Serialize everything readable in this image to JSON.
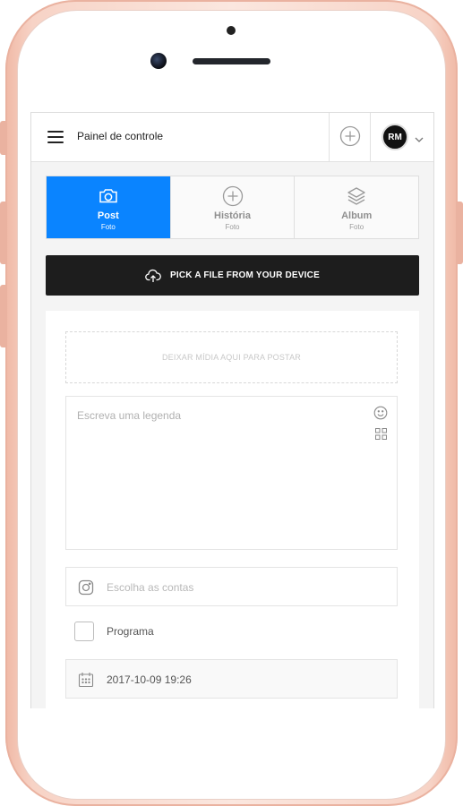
{
  "header": {
    "title": "Painel de controle",
    "avatar_initials": "RM"
  },
  "tabs": [
    {
      "label": "Post",
      "sub": "Foto",
      "icon": "camera-icon",
      "active": true
    },
    {
      "label": "História",
      "sub": "Foto",
      "icon": "plus-circle-icon",
      "active": false
    },
    {
      "label": "Album",
      "sub": "Foto",
      "icon": "layers-icon",
      "active": false
    }
  ],
  "upload": {
    "button_label": "PICK A FILE FROM YOUR DEVICE",
    "icon": "cloud-upload-icon"
  },
  "form": {
    "dropzone_text": "DEIXAR MÍDIA AQUI PARA POSTAR",
    "caption_placeholder": "Escreva uma legenda",
    "accounts_placeholder": "Escolha as contas",
    "schedule_label": "Programa",
    "date_value": "2017-10-09 19:26"
  },
  "colors": {
    "accent": "#0a84ff",
    "button_dark": "#1d1d1d",
    "frame": "#f7d3c6"
  }
}
